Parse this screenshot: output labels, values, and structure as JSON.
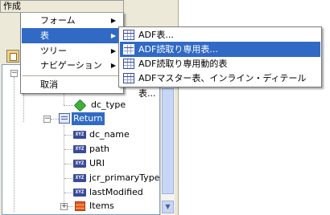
{
  "context_menu": {
    "title": "作成",
    "items": [
      {
        "label": "フォーム",
        "has_submenu": true
      },
      {
        "label": "表",
        "has_submenu": true,
        "active": true
      },
      {
        "label": "ツリー",
        "has_submenu": true
      },
      {
        "label": "ナビゲーション",
        "has_submenu": true
      },
      {
        "label": "取消",
        "has_submenu": false
      }
    ],
    "submenu_arrow": "▶"
  },
  "table_submenu": {
    "items": [
      {
        "label": "ADF表...",
        "icon": "table-icon"
      },
      {
        "label": "ADF読取り専用表...",
        "icon": "table-icon",
        "active": true
      },
      {
        "label": "ADF読取り専用動的表",
        "icon": "table-icon"
      },
      {
        "label": "ADFマスター表、インライン・ディテール表...",
        "icon": "table-icon"
      }
    ]
  },
  "tree": {
    "nodes": [
      {
        "label": "dc_type",
        "icon": "green-cube-icon"
      },
      {
        "label": "Return",
        "icon": "return-icon",
        "selected": true
      },
      {
        "label": "dc_name",
        "icon": "xyz-attribute-icon"
      },
      {
        "label": "path",
        "icon": "xyz-attribute-icon"
      },
      {
        "label": "URI",
        "icon": "xyz-attribute-icon"
      },
      {
        "label": "jcr_primaryType",
        "icon": "xyz-attribute-icon"
      },
      {
        "label": "lastModified",
        "icon": "xyz-attribute-icon"
      },
      {
        "label": "Items",
        "icon": "collection-icon"
      }
    ],
    "attr_badge": "XYZ",
    "expand_glyph": "−",
    "collapse_glyph": "+"
  },
  "scrollbar": {
    "down_glyph": "▼"
  },
  "colors": {
    "selection": "#316ac5",
    "menu_border": "#7a7a7a",
    "panel_bg": "#ece9d8"
  }
}
